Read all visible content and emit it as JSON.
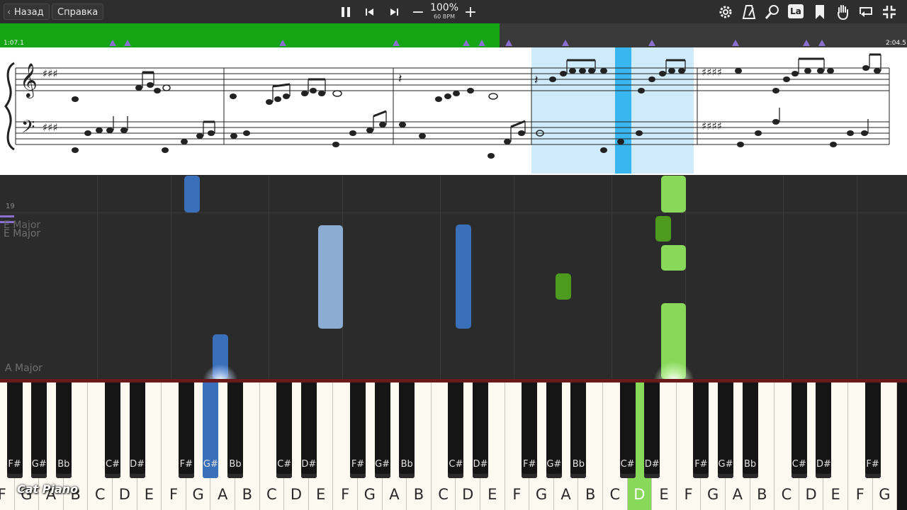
{
  "topbar": {
    "back_label": "Назад",
    "help_label": "Справка",
    "tempo_percent": "100%",
    "tempo_bpm": "60 BPM",
    "icons": [
      "settings-gear-icon",
      "metronome-icon",
      "zoom-icon",
      "note-labels-icon",
      "bookmark-icon",
      "hand-icon",
      "loop-icon",
      "fullscreen-exit-icon"
    ],
    "label_toggle": "La"
  },
  "progress": {
    "start_time": "1:07.1",
    "end_time": "2:04.5",
    "played_fraction": 0.551,
    "fill_color": "#14a414",
    "marker_color": "#8a6fd0"
  },
  "sheet": {
    "highlight_color": "#cfeafb",
    "cursor_color": "#39b5f0"
  },
  "roll": {
    "measure_number": "19",
    "key_change_ghost": "E Major",
    "key_change": "E Major",
    "key_signature": "A Major",
    "left_hand_color": "#3a6fba",
    "right_hand_color": "#88d85a"
  },
  "keyboard": {
    "white_keys": [
      "F",
      "G",
      "A",
      "B",
      "C",
      "D",
      "E",
      "F",
      "G",
      "A",
      "B",
      "C",
      "D",
      "E",
      "F",
      "G",
      "A",
      "B",
      "C",
      "D",
      "E",
      "F",
      "G",
      "A",
      "B",
      "C",
      "D",
      "E",
      "F",
      "G",
      "A",
      "B",
      "C",
      "D",
      "E",
      "F",
      "G"
    ],
    "black_keys": [
      "F#",
      "G#",
      "Bb",
      "C#",
      "D#",
      "F#",
      "G#",
      "Bb",
      "C#",
      "D#",
      "F#",
      "G#",
      "Bb",
      "C#",
      "D#",
      "F#",
      "G#",
      "Bb",
      "C#",
      "D#",
      "F#",
      "G#",
      "Bb",
      "C#",
      "D#",
      "F#",
      "G#",
      "Bb",
      "C#",
      "D#",
      "F#",
      "G#",
      "Bb",
      "C#",
      "D#",
      "F#",
      "G#"
    ],
    "pressed_white": "E",
    "pressed_black": "G#"
  },
  "watermark": "Cat Piano"
}
